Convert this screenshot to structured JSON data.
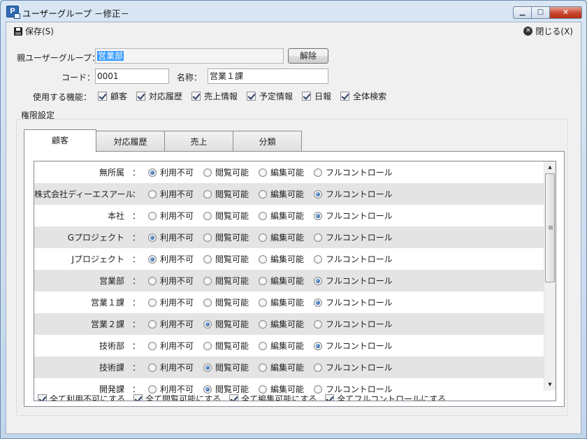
{
  "window": {
    "title": "ユーザーグループ －修正－",
    "min_glyph": "▁",
    "max_glyph": "□",
    "close_glyph": "✕"
  },
  "toolbar": {
    "save_label": "保存(S)",
    "close_label": "閉じる(X)"
  },
  "form": {
    "parent_label": "親ユーザーグループ：",
    "parent_value": "営業部",
    "clear_button": "解除",
    "code_label": "コード：",
    "code_value": "0001",
    "name_label": "名称：",
    "name_value": "営業１課",
    "features_label": "使用する機能：",
    "features": [
      {
        "label": "顧客",
        "checked": true
      },
      {
        "label": "対応履歴",
        "checked": true
      },
      {
        "label": "売上情報",
        "checked": true
      },
      {
        "label": "予定情報",
        "checked": true
      },
      {
        "label": "日報",
        "checked": true
      },
      {
        "label": "全体検索",
        "checked": true
      }
    ]
  },
  "permissions": {
    "group_label": "権限設定",
    "tabs": [
      {
        "label": "顧客",
        "active": true
      },
      {
        "label": "対応履歴",
        "active": false
      },
      {
        "label": "売上",
        "active": false
      },
      {
        "label": "分類",
        "active": false
      }
    ],
    "options": [
      "利用不可",
      "閲覧可能",
      "編集可能",
      "フルコントロール"
    ],
    "colon": "：",
    "rows": [
      {
        "name": "無所属",
        "selected": 0
      },
      {
        "name": "株式会社ディーエスアール",
        "selected": 3
      },
      {
        "name": "本社",
        "selected": 3
      },
      {
        "name": "Gプロジェクト",
        "selected": 0
      },
      {
        "name": "Jプロジェクト",
        "selected": 0
      },
      {
        "name": "営業部",
        "selected": 3
      },
      {
        "name": "営業１課",
        "selected": 3
      },
      {
        "name": "営業２課",
        "selected": 1
      },
      {
        "name": "技術部",
        "selected": 3
      },
      {
        "name": "技術課",
        "selected": 1
      },
      {
        "name": "開発課",
        "selected": 1
      }
    ],
    "bulk_actions": [
      {
        "label": "全て利用不可にする",
        "checked": true
      },
      {
        "label": "全て閲覧可能にする",
        "checked": true
      },
      {
        "label": "全て編集可能にする",
        "checked": true
      },
      {
        "label": "全てフルコントロールにする",
        "checked": true
      }
    ],
    "scroll_up_glyph": "▲",
    "scroll_down_glyph": "▼"
  }
}
